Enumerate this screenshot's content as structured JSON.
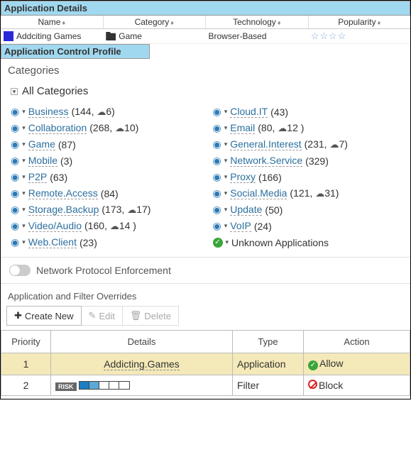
{
  "app_details": {
    "header": "Application Details",
    "cols": {
      "name": "Name",
      "category": "Category",
      "technology": "Technology",
      "popularity": "Popularity"
    },
    "row": {
      "name": "Addciting Games",
      "category": "Game",
      "technology": "Browser-Based"
    }
  },
  "profile_header": "Application Control Profile",
  "categories_title": "Categories",
  "all_categories_label": "All Categories",
  "categories_left": [
    {
      "name": "Business",
      "count": "(144,",
      "cloud": "6)"
    },
    {
      "name": "Collaboration",
      "count": "(268,",
      "cloud": "10)"
    },
    {
      "name": "Game",
      "count": "(87)"
    },
    {
      "name": "Mobile",
      "count": "(3)"
    },
    {
      "name": "P2P",
      "count": "(63)"
    },
    {
      "name": "Remote.Access",
      "count": "(84)"
    },
    {
      "name": "Storage.Backup",
      "count": "(173,",
      "cloud": "17)"
    },
    {
      "name": "Video/Audio",
      "count": "(160,",
      "cloud": "14 )"
    },
    {
      "name": "Web.Client",
      "count": "(23)"
    }
  ],
  "categories_right": [
    {
      "name": "Cloud.IT",
      "count": "(43)"
    },
    {
      "name": "Email",
      "count": "(80,",
      "cloud": "12 )"
    },
    {
      "name": "General.Interest",
      "count": "(231,",
      "cloud": "7)"
    },
    {
      "name": "Network.Service",
      "count": "(329)"
    },
    {
      "name": "Proxy",
      "count": "(166)"
    },
    {
      "name": "Social.Media",
      "count": "(121,",
      "cloud": "31)"
    },
    {
      "name": "Update",
      "count": "(50)"
    },
    {
      "name": "VoIP",
      "count": "(24)"
    },
    {
      "name": "Unknown Applications",
      "special": true
    }
  ],
  "npe_label": "Network Protocol Enforcement",
  "overrides_title": "Application and Filter Overrides",
  "toolbar": {
    "create": "Create New",
    "edit": "Edit",
    "delete": "Delete"
  },
  "table": {
    "headers": {
      "priority": "Priority",
      "details": "Details",
      "type": "Type",
      "action": "Action"
    },
    "rows": [
      {
        "priority": "1",
        "details": "Addicting.Games",
        "type": "Application",
        "action": "Allow"
      },
      {
        "priority": "2",
        "type": "Filter",
        "action": "Block"
      }
    ]
  }
}
